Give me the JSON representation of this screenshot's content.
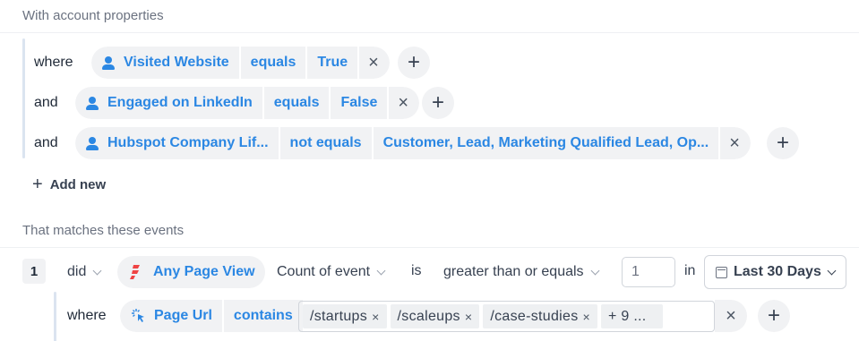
{
  "account_section": {
    "title": "With account properties",
    "filters": [
      {
        "connector": "where",
        "property": "Visited Website",
        "operator": "equals",
        "value": "True"
      },
      {
        "connector": "and",
        "property": "Engaged on LinkedIn",
        "operator": "equals",
        "value": "False"
      },
      {
        "connector": "and",
        "property": "Hubspot Company Lif...",
        "operator": "not equals",
        "value": "Customer, Lead, Marketing Qualified Lead, Op..."
      }
    ],
    "add_new_label": "Add new"
  },
  "events_section": {
    "title": "That matches these events",
    "event": {
      "index": "1",
      "did_label": "did",
      "event_name": "Any Page View",
      "aggregation": "Count of event",
      "is_label": "is",
      "comparator": "greater than or equals",
      "count_value": "1",
      "in_label": "in",
      "date_range": "Last 30 Days",
      "sub_filter": {
        "connector": "where",
        "property": "Page Url",
        "operator": "contains",
        "values": [
          "/startups",
          "/scaleups",
          "/case-studies"
        ],
        "more_label": "+ 9 ..."
      }
    }
  },
  "colors": {
    "accent": "#2b87e3",
    "pill_bg": "#f1f2f4",
    "event_icon": "#ef4444"
  },
  "icons": {
    "person": "person-icon",
    "close": "close-icon",
    "plus": "plus-icon",
    "chevron": "chevron-down-icon",
    "calendar": "calendar-icon",
    "event": "bolt-icon",
    "pointer": "cursor-click-icon"
  }
}
